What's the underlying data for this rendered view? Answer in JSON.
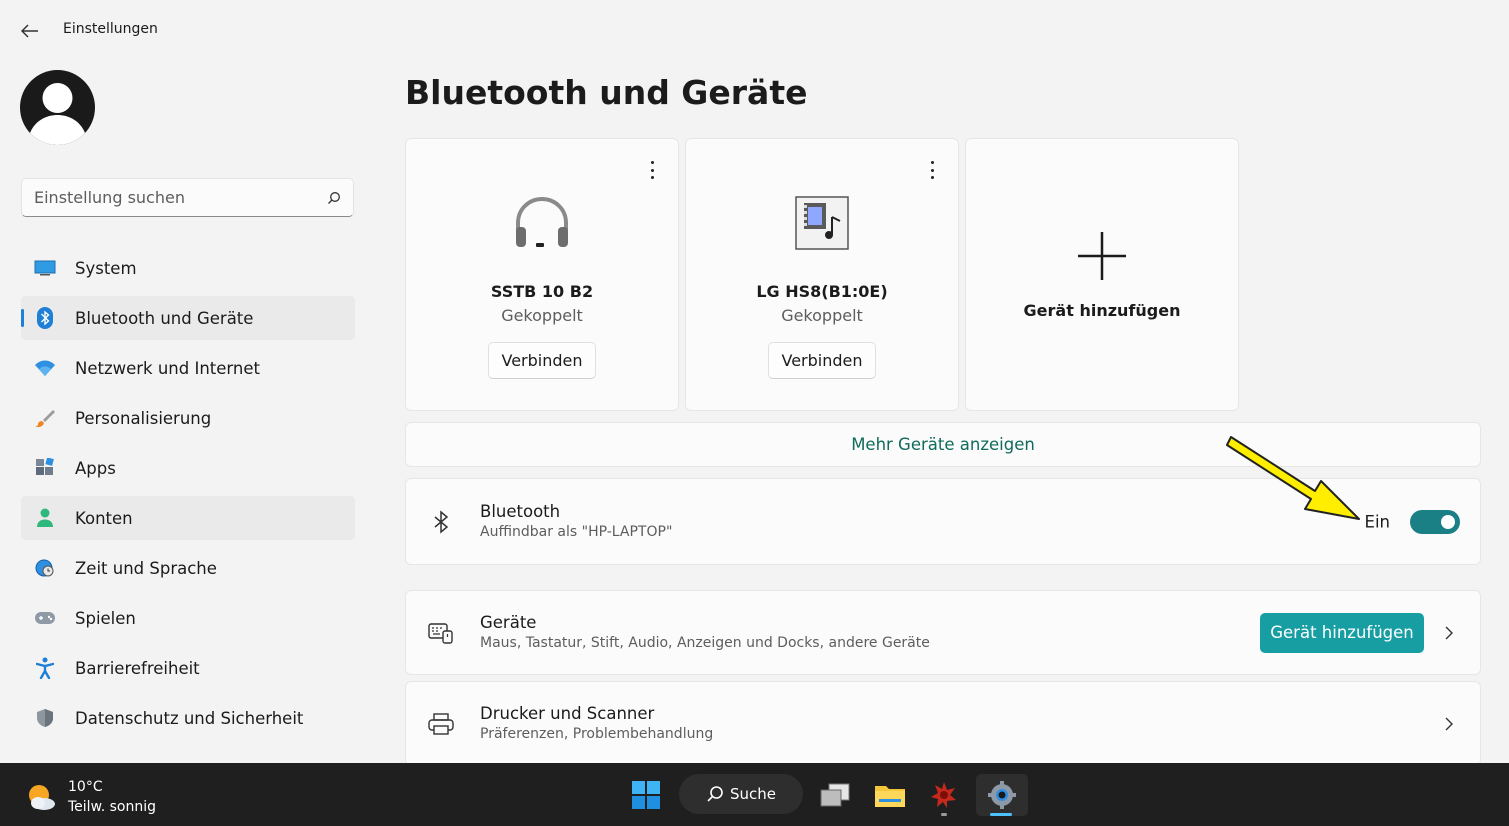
{
  "window": {
    "title": "Einstellungen"
  },
  "sidebar": {
    "search_placeholder": "Einstellung suchen",
    "items": [
      {
        "label": "System",
        "icon": "monitor-icon"
      },
      {
        "label": "Bluetooth und Geräte",
        "icon": "bluetooth-icon",
        "active": true
      },
      {
        "label": "Netzwerk und Internet",
        "icon": "wifi-icon"
      },
      {
        "label": "Personalisierung",
        "icon": "brush-icon"
      },
      {
        "label": "Apps",
        "icon": "apps-icon"
      },
      {
        "label": "Konten",
        "icon": "person-icon"
      },
      {
        "label": "Zeit und Sprache",
        "icon": "globe-clock-icon"
      },
      {
        "label": "Spielen",
        "icon": "gamepad-icon"
      },
      {
        "label": "Barrierefreiheit",
        "icon": "accessibility-icon"
      },
      {
        "label": "Datenschutz und Sicherheit",
        "icon": "shield-icon"
      }
    ]
  },
  "main": {
    "title": "Bluetooth und Geräte",
    "devices": [
      {
        "name": "SSTB 10 B2",
        "status": "Gekoppelt",
        "button": "Verbinden",
        "icon": "headset-icon"
      },
      {
        "name": "LG HS8(B1:0E)",
        "status": "Gekoppelt",
        "button": "Verbinden",
        "icon": "media-device-icon"
      }
    ],
    "add_device_card": "Gerät hinzufügen",
    "more_devices": "Mehr Geräte anzeigen",
    "bluetooth": {
      "title": "Bluetooth",
      "subtitle": "Auffindbar als \"HP-LAPTOP\"",
      "state": "Ein",
      "on": true
    },
    "devices_row": {
      "title": "Geräte",
      "subtitle": "Maus, Tastatur, Stift, Audio, Anzeigen und Docks, andere Geräte",
      "button": "Gerät hinzufügen"
    },
    "printers_row": {
      "title": "Drucker und Scanner",
      "subtitle": "Präferenzen, Problembehandlung"
    }
  },
  "taskbar": {
    "temperature": "10°C",
    "condition": "Teilw. sonnig",
    "search_label": "Suche"
  },
  "colors": {
    "accent": "#179ea3",
    "toggle": "#1b7f86",
    "link": "#0f6b5c",
    "annotation_arrow": "#ffee00"
  }
}
